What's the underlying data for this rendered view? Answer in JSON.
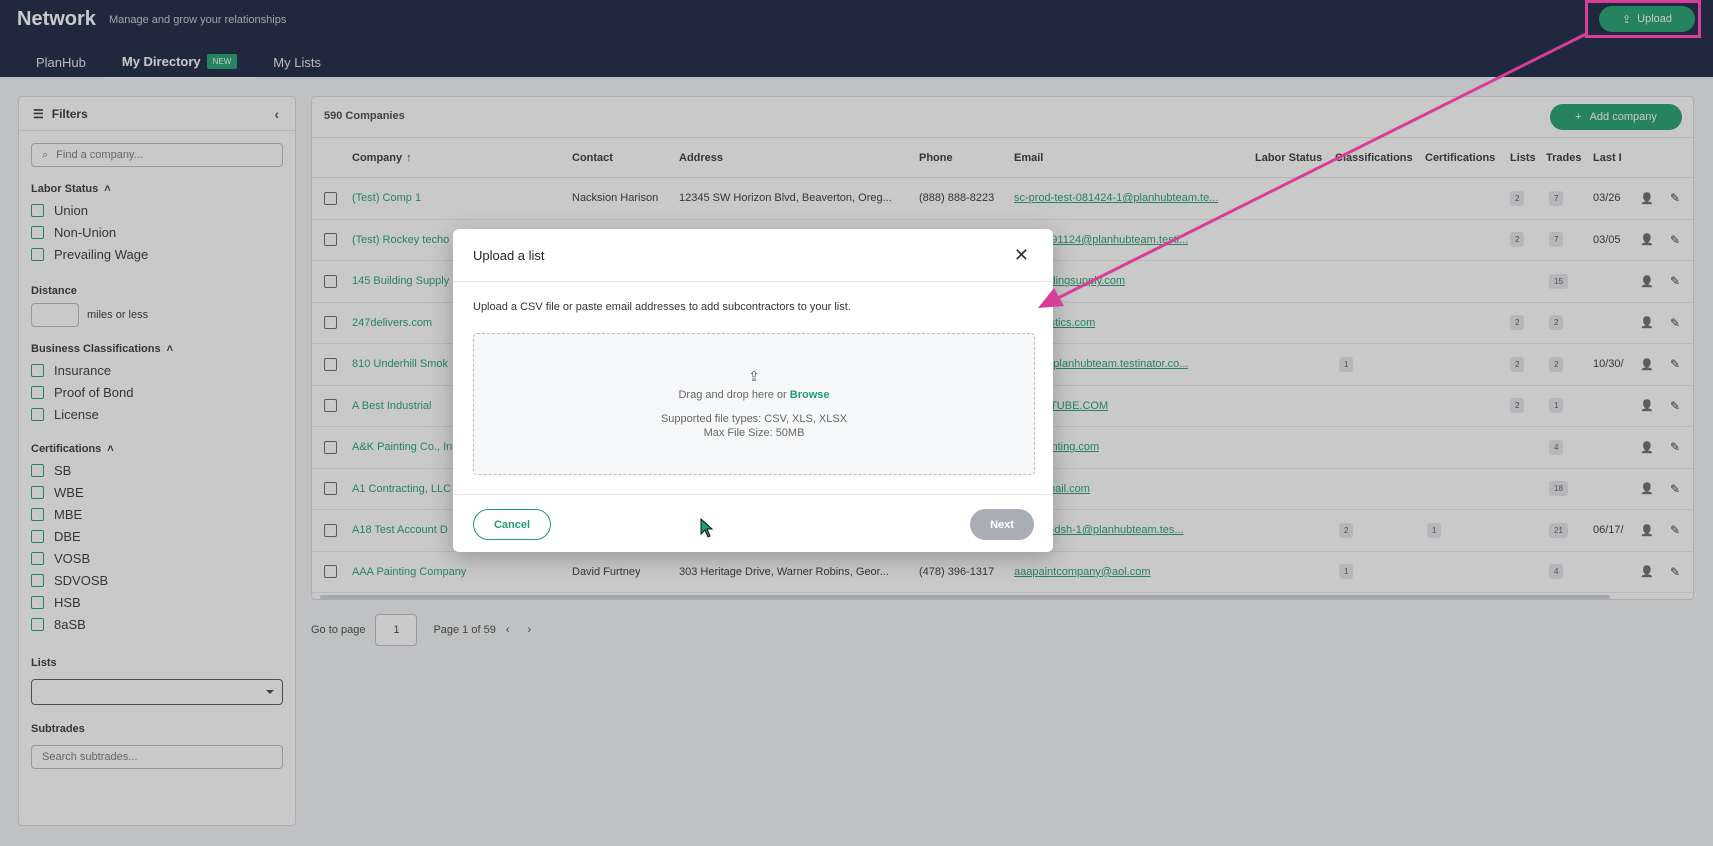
{
  "header": {
    "title": "Network",
    "subtitle": "Manage and grow your relationships",
    "upload_label": "Upload",
    "tabs": [
      {
        "label": "PlanHub"
      },
      {
        "label": "My Directory",
        "badge": "NEW"
      },
      {
        "label": "My Lists"
      }
    ]
  },
  "sidebar": {
    "title": "Filters",
    "search_placeholder": "Find a company...",
    "labor_status": {
      "title": "Labor Status",
      "options": [
        "Union",
        "Non-Union",
        "Prevailing Wage"
      ]
    },
    "distance": {
      "title": "Distance",
      "suffix": "miles or less"
    },
    "business": {
      "title": "Business Classifications",
      "options": [
        "Insurance",
        "Proof of Bond",
        "License"
      ]
    },
    "certifications": {
      "title": "Certifications",
      "options": [
        "SB",
        "WBE",
        "MBE",
        "DBE",
        "VOSB",
        "SDVOSB",
        "HSB",
        "8aSB"
      ]
    },
    "lists": {
      "title": "Lists"
    },
    "subtrades": {
      "title": "Subtrades",
      "placeholder": "Search subtrades..."
    }
  },
  "main": {
    "count": "590 Companies",
    "add_company": "Add company",
    "columns": [
      "Company",
      "Contact",
      "Address",
      "Phone",
      "Email",
      "Labor Status",
      "Classifications",
      "Certifications",
      "Lists",
      "Trades",
      "Last I"
    ],
    "rows": [
      {
        "company": "(Test) Comp 1",
        "contact": "Nacksion Harison",
        "address": "12345 SW Horizon Blvd, Beaverton, Oreg...",
        "phone": "(888) 888-8223",
        "email": "sc-prod-test-081424-1@planhubteam.te...",
        "classif": "",
        "cert": "",
        "lists": "2",
        "trades": "7",
        "last": "03/26"
      },
      {
        "company": "(Test) Rockey techo",
        "contact": "",
        "address": "",
        "phone": "",
        "email": "d-test-091124@planhubteam.testi...",
        "classif": "",
        "cert": "",
        "lists": "2",
        "trades": "7",
        "last": "03/05"
      },
      {
        "company": "145 Building Supply",
        "contact": "",
        "address": "",
        "phone": "",
        "email": "145buildingsupply.com",
        "classif": "",
        "cert": "",
        "lists": "",
        "trades": "15",
        "last": ""
      },
      {
        "company": "247delivers.com",
        "contact": "",
        "address": "",
        "phone": "",
        "email": "npdlogistics.com",
        "classif": "",
        "cert": "",
        "lists": "2",
        "trades": "2",
        "last": ""
      },
      {
        "company": "810 Underhill Smok",
        "contact": "",
        "address": "",
        "phone": "",
        "email": "0-810@planhubteam.testinator.co...",
        "classif": "1",
        "cert": "",
        "lists": "2",
        "trades": "2",
        "last": "10/30/"
      },
      {
        "company": "A Best Industrial",
        "contact": "",
        "address": "",
        "phone": "",
        "email": "ABESTTUBE.COM",
        "classif": "",
        "cert": "",
        "lists": "2",
        "trades": "1",
        "last": ""
      },
      {
        "company": "A&K Painting Co., In",
        "contact": "",
        "address": "",
        "phone": "",
        "email": "@akpainting.com",
        "classif": "",
        "cert": "",
        "lists": "",
        "trades": "4",
        "last": ""
      },
      {
        "company": "A1 Contracting, LLC",
        "contact": "",
        "address": "",
        "phone": "",
        "email": "tes@gmail.com",
        "classif": "",
        "cert": "",
        "lists": "",
        "trades": "18",
        "last": ""
      },
      {
        "company": "A18 Test Account D",
        "contact": "",
        "address": "",
        "phone": "",
        "email": "081324-dsh-1@planhubteam.tes...",
        "classif": "2",
        "cert": "1",
        "lists": "",
        "trades": "21",
        "last": "06/17/"
      },
      {
        "company": "AAA Painting Company",
        "contact": "David Furtney",
        "address": "303 Heritage Drive, Warner Robins, Geor...",
        "phone": "(478) 396-1317",
        "email": "aaapaintcompany@aol.com",
        "classif": "1",
        "cert": "",
        "lists": "",
        "trades": "4",
        "last": ""
      }
    ]
  },
  "pager": {
    "label": "Go to page",
    "value": "1",
    "status": "Page 1 of 59"
  },
  "modal": {
    "title": "Upload a list",
    "description": "Upload a CSV file or paste email addresses to add subcontractors to your list.",
    "drop_text": "Drag and drop here or",
    "browse": "Browse",
    "types": "Supported file types: CSV, XLS, XLSX",
    "max_size": "Max File Size: 50MB",
    "cancel": "Cancel",
    "next": "Next"
  },
  "colors": {
    "accent": "#1d9f6e",
    "header_bg": "#14213d",
    "annotation": "#d63e97"
  }
}
